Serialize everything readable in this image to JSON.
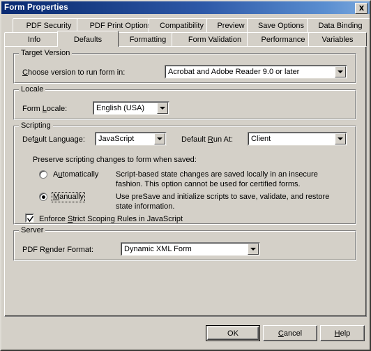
{
  "window": {
    "title": "Form Properties",
    "close_icon": "close-icon"
  },
  "tabs": {
    "row1": [
      {
        "label": "PDF Security",
        "active": false
      },
      {
        "label": "PDF Print Options",
        "active": false
      },
      {
        "label": "Compatibility",
        "active": false
      },
      {
        "label": "Preview",
        "active": false
      },
      {
        "label": "Save Options",
        "active": false
      },
      {
        "label": "Data Binding",
        "active": false
      }
    ],
    "row2": [
      {
        "label": "Info",
        "active": false
      },
      {
        "label": "Defaults",
        "active": true
      },
      {
        "label": "Formatting",
        "active": false
      },
      {
        "label": "Form Validation",
        "active": false
      },
      {
        "label": "Performance",
        "active": false
      },
      {
        "label": "Variables",
        "active": false
      }
    ]
  },
  "target_version": {
    "group_title": "Target Version",
    "label_pre": "",
    "label_accel": "C",
    "label_post": "hoose version to run form in:",
    "combo_value": "Acrobat and Adobe Reader 9.0 or later"
  },
  "locale": {
    "group_title": "Locale",
    "label_pre": "Form ",
    "label_accel": "L",
    "label_post": "ocale:",
    "combo_value": "English (USA)"
  },
  "scripting": {
    "group_title": "Scripting",
    "language_label_pre": "Def",
    "language_label_accel": "a",
    "language_label_post": "ult Language:",
    "language_value": "JavaScript",
    "runat_label_pre": "Default ",
    "runat_label_accel": "R",
    "runat_label_post": "un At:",
    "runat_value": "Client",
    "preserve_label": "Preserve scripting changes to form when saved:",
    "radio_auto": {
      "label_pre": "A",
      "label_accel": "u",
      "label_post": "tomatically",
      "selected": false,
      "description": "Script-based state changes are saved locally in an insecure fashion. This option cannot be used for certified forms."
    },
    "radio_manual": {
      "label_pre": "",
      "label_accel": "M",
      "label_post": "anually",
      "selected": true,
      "focused": true,
      "description": "Use preSave and initialize scripts to save, validate, and restore state information."
    },
    "strict_checkbox": {
      "label_pre": "Enforce ",
      "label_accel": "S",
      "label_post": "trict Scoping Rules in JavaScript",
      "checked": true
    }
  },
  "server": {
    "group_title": "Server",
    "label_pre": "PDF R",
    "label_accel": "e",
    "label_post": "nder Format:",
    "combo_value": "Dynamic XML Form"
  },
  "buttons": {
    "ok": {
      "label": "OK",
      "default": true
    },
    "cancel": {
      "label_pre": "",
      "label_accel": "C",
      "label_post": "ancel"
    },
    "help": {
      "label_pre": "",
      "label_accel": "H",
      "label_post": "elp"
    }
  },
  "colors": {
    "face": "#d4d0c8",
    "title_start": "#0a2a72",
    "title_end": "#7aa8dd",
    "field_bg": "#ffffff",
    "text": "#000000"
  }
}
